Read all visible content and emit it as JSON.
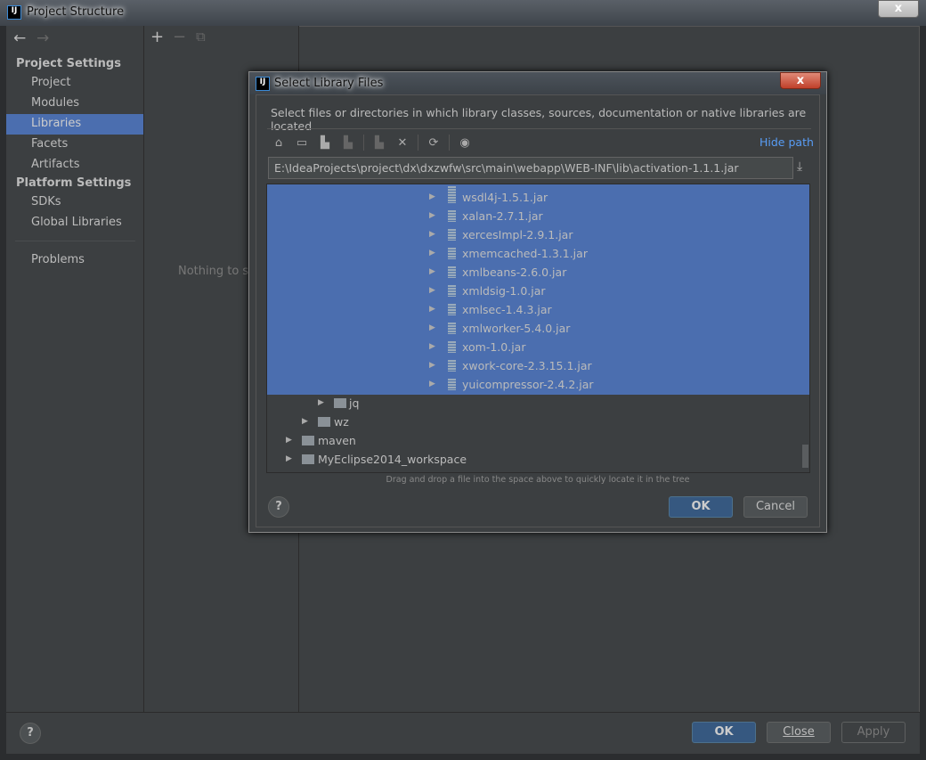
{
  "window": {
    "title": "Project Structure",
    "close": "x"
  },
  "sidebar": {
    "nav": {
      "back": "←",
      "forward": "→"
    },
    "project_settings_header": "Project Settings",
    "project_items": [
      {
        "label": "Project"
      },
      {
        "label": "Modules"
      },
      {
        "label": "Libraries",
        "selected": true
      },
      {
        "label": "Facets"
      },
      {
        "label": "Artifacts"
      }
    ],
    "platform_settings_header": "Platform Settings",
    "platform_items": [
      {
        "label": "SDKs"
      },
      {
        "label": "Global Libraries"
      }
    ],
    "problems": "Problems"
  },
  "middle": {
    "add": "+",
    "remove": "−",
    "copy": "⧉",
    "empty_text": "Nothing to show"
  },
  "footer": {
    "help": "?",
    "ok": "OK",
    "close": "Close",
    "apply": "Apply"
  },
  "dialog": {
    "title": "Select Library Files",
    "close": "x",
    "description": "Select files or directories in which library classes, sources, documentation or native libraries are located",
    "toolbar": {
      "home": "⌂",
      "desktop": "▭",
      "project": "▙",
      "module": "▙",
      "new_folder": "▙",
      "delete": "✕",
      "refresh": "⟳",
      "show_hidden": "◉",
      "hide_path": "Hide path"
    },
    "path_value": "E:\\IdeaProjects\\project\\dx\\dxzwfw\\src\\main\\webapp\\WEB-INF\\lib\\activation-1.1.1.jar",
    "download": "⤓",
    "tree": {
      "selected_jars": [
        "wsdl4j-1.5.1.jar",
        "xalan-2.7.1.jar",
        "xercesImpl-2.9.1.jar",
        "xmemcached-1.3.1.jar",
        "xmlbeans-2.6.0.jar",
        "xmldsig-1.0.jar",
        "xmlsec-1.4.3.jar",
        "xmlworker-5.4.0.jar",
        "xom-1.0.jar",
        "xwork-core-2.3.15.1.jar",
        "yuicompressor-2.4.2.jar"
      ],
      "folders": [
        {
          "label": "jq",
          "level": 3
        },
        {
          "label": "wz",
          "level": 2
        },
        {
          "label": "maven",
          "level": 1
        },
        {
          "label": "MyEclipse2014_workspace",
          "level": 1
        }
      ]
    },
    "hint": "Drag and drop a file into the space above to quickly locate it in the tree",
    "help": "?",
    "ok": "OK",
    "cancel": "Cancel"
  },
  "colors": {
    "selection": "#4b6eaf",
    "background": "#3c3f41",
    "link": "#589df6",
    "default_button": "#365880"
  }
}
